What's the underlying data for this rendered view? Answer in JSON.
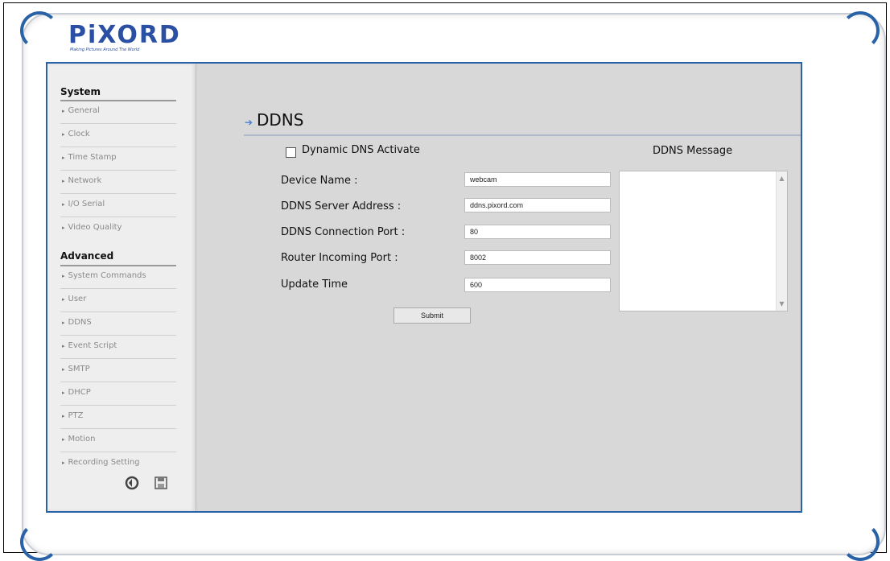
{
  "brand": {
    "logo": "PiXORD",
    "tagline": "Making Pictures Around The World"
  },
  "sidebar": {
    "system": {
      "title": "System",
      "items": [
        "General",
        "Clock",
        "Time Stamp",
        "Network",
        "I/O Serial",
        "Video Quality"
      ]
    },
    "advanced": {
      "title": "Advanced",
      "items": [
        "System Commands",
        "User",
        "DDNS",
        "Event Script",
        "SMTP",
        "DHCP",
        "PTZ",
        "Motion",
        "Recording Setting"
      ]
    },
    "icons": {
      "back": "back-arrow-icon",
      "save": "save-icon"
    }
  },
  "page": {
    "title": "DDNS",
    "activate_label": "Dynamic DNS Activate",
    "activate_checked": false,
    "fields": [
      {
        "label": "Device Name :",
        "value": "webcam"
      },
      {
        "label": "DDNS Server Address :",
        "value": "ddns.pixord.com"
      },
      {
        "label": "DDNS Connection Port :",
        "value": "80"
      },
      {
        "label": "Router Incoming Port :",
        "value": "8002"
      },
      {
        "label": "Update Time",
        "value": "600"
      }
    ],
    "submit_label": "Submit",
    "message_title": "DDNS Message",
    "message_text": ""
  },
  "colors": {
    "accent": "#2a62a8",
    "content_bg": "#d8d8d8",
    "sidebar_bg": "#eeeeee"
  }
}
